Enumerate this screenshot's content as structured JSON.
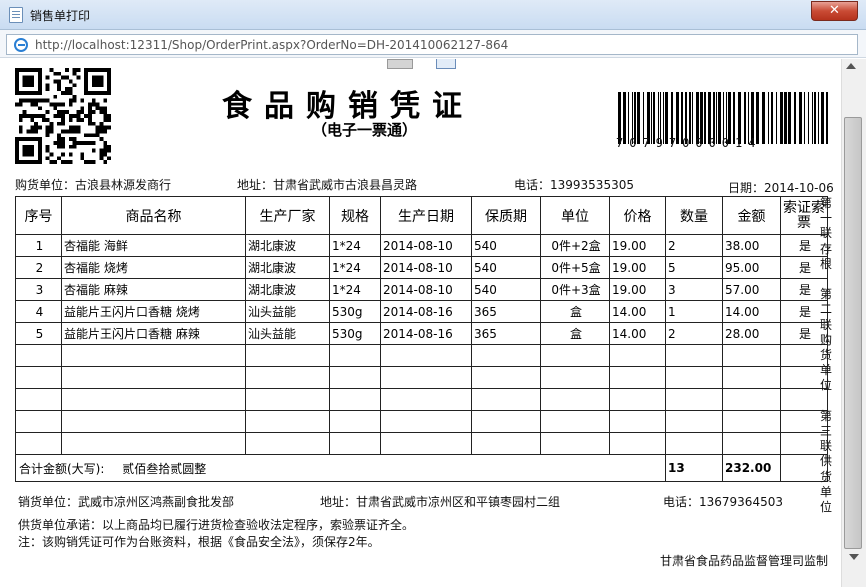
{
  "window": {
    "title": "销售单打印",
    "close_label": "✕"
  },
  "address": {
    "url": "http://localhost:12311/Shop/OrderPrint.aspx?OrderNo=DH-201410062127-864"
  },
  "doc": {
    "title": "食品购销凭证",
    "subtitle": "（电子一票通）",
    "barcode_number": "70797000014",
    "buyer": "购货单位：古浪县林源发商行",
    "buyer_address": "地址：甘肃省武威市古浪县昌灵路",
    "buyer_phone": "电话：13993535305",
    "date": "日期：2014-10-06",
    "table": {
      "headers": [
        "序号",
        "商品名称",
        "生产厂家",
        "规格",
        "生产日期",
        "保质期",
        "单位",
        "价格",
        "数量",
        "金额",
        "索证索票"
      ],
      "rows": [
        [
          "1",
          "杏福能 海鲜",
          "湖北康波",
          "1*24",
          "2014-08-10",
          "540",
          "0件+2盒",
          "19.00",
          "2",
          "38.00",
          "是"
        ],
        [
          "2",
          "杏福能 烧烤",
          "湖北康波",
          "1*24",
          "2014-08-10",
          "540",
          "0件+5盒",
          "19.00",
          "5",
          "95.00",
          "是"
        ],
        [
          "3",
          "杏福能 麻辣",
          "湖北康波",
          "1*24",
          "2014-08-10",
          "540",
          "0件+3盒",
          "19.00",
          "3",
          "57.00",
          "是"
        ],
        [
          "4",
          "益能片王闪片口香糖 烧烤",
          "汕头益能",
          "530g",
          "2014-08-16",
          "365",
          "盒",
          "14.00",
          "1",
          "14.00",
          "是"
        ],
        [
          "5",
          "益能片王闪片口香糖 麻辣",
          "汕头益能",
          "530g",
          "2014-08-16",
          "365",
          "盒",
          "14.00",
          "2",
          "28.00",
          "是"
        ]
      ],
      "total_label": "合计金额(大写):",
      "total_words": "贰佰叁拾贰圆整",
      "total_qty": "13",
      "total_amount": "232.00"
    },
    "side_text": "第一联存根 第二联购货单位 第三联供货单位",
    "seller": "销货单位：武威市凉州区鸿燕副食批发部",
    "seller_address": "地址：甘肃省武威市凉州区和平镇枣园村二组",
    "seller_phone": "电话：13679364503",
    "promise": "供货单位承诺：以上商品均已履行进货检查验收法定程序，索验票证齐全。",
    "note": "注：该购销凭证可作为台账资料，根据《食品安全法》，须保存2年。",
    "authority": "甘肃省食品药品监督管理司监制"
  }
}
